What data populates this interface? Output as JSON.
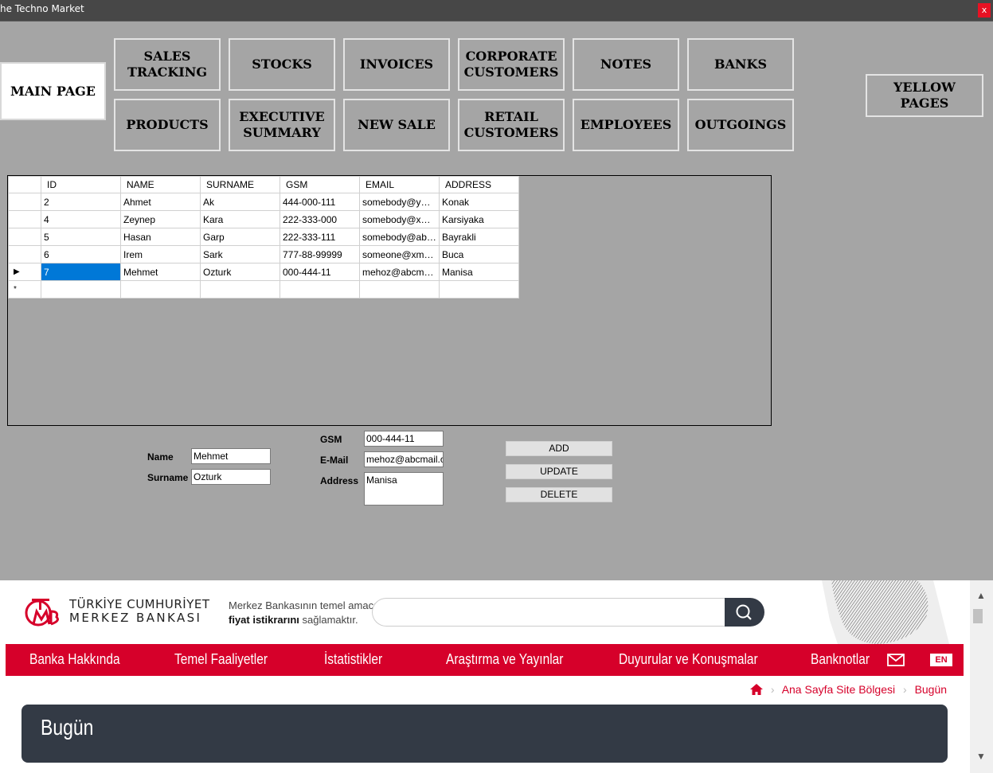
{
  "window": {
    "title": "he Techno Market",
    "close_label": "x"
  },
  "nav": {
    "main_page": "MAIN PAGE",
    "sales_tracking": "SALES\nTRACKING",
    "stocks": "STOCKS",
    "invoices": "INVOICES",
    "corporate_customers": "CORPORATE\nCUSTOMERS",
    "notes": "NOTES",
    "banks": "BANKS",
    "products": "PRODUCTS",
    "executive_summary": "EXECUTIVE\nSUMMARY",
    "new_sale": "NEW SALE",
    "retail_customers": "RETAIL\nCUSTOMERS",
    "employees": "EMPLOYEES",
    "outgoings": "OUTGOINGS",
    "yellow_pages": "YELLOW PAGES"
  },
  "grid": {
    "columns": [
      "ID",
      "NAME",
      "SURNAME",
      "GSM",
      "EMAIL",
      "ADDRESS"
    ],
    "rows": [
      [
        "2",
        "Ahmet",
        "Ak",
        "444-000-111",
        "somebody@ymail....",
        "Konak"
      ],
      [
        "4",
        "Zeynep",
        "Kara",
        "222-333-000",
        "somebody@xmail....",
        "Karsiyaka"
      ],
      [
        "5",
        "Hasan",
        "Garp",
        "222-333-111",
        "somebody@abc....",
        "Bayrakli"
      ],
      [
        "6",
        "Irem",
        "Sark",
        "777-88-99999",
        "someone@xmail....",
        "Buca"
      ],
      [
        "7",
        "Mehmet",
        "Ozturk",
        "000-444-11",
        "mehoz@abcmail....",
        "Manisa"
      ]
    ],
    "current_row_marker": "▶",
    "new_row_marker": "*"
  },
  "form": {
    "name_label": "Name",
    "name_value": "Mehmet",
    "surname_label": "Surname",
    "surname_value": "Ozturk",
    "gsm_label": "GSM",
    "gsm_value": "000-444-11",
    "email_label": "E-Mail",
    "email_value": "mehoz@abcmail.cor",
    "address_label": "Address",
    "address_value": "Manisa",
    "add_label": "ADD",
    "update_label": "UPDATE",
    "delete_label": "DELETE"
  },
  "web": {
    "bank_line1": "TÜRKİYE CUMHURİYET",
    "bank_line2": "MERKEZ BANKASI",
    "motto_line1": "Merkez Bankasının temel amacı",
    "motto_bold": "fiyat istikrarını",
    "motto_rest": " sağlamaktır.",
    "menu": [
      "Banka Hakkında",
      "Temel Faaliyetler",
      "İstatistikler",
      "Araştırma ve Yayınlar",
      "Duyurular ve Konuşmalar",
      "Banknotlar"
    ],
    "lang": "EN",
    "breadcrumb": [
      "Ana Sayfa Site Bölgesi",
      "Bugün"
    ],
    "page_title": "Bugün",
    "brand_color": "#d6002a",
    "dark_color": "#333a45"
  }
}
